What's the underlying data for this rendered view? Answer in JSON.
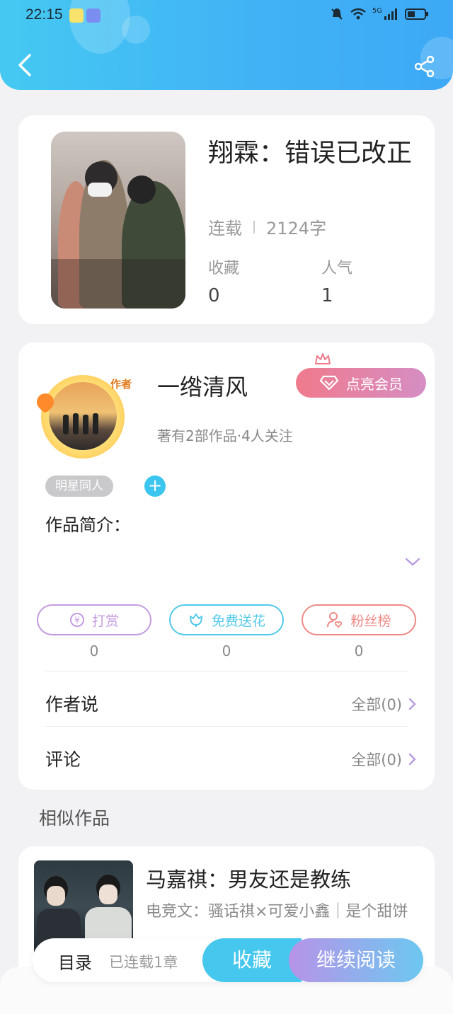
{
  "status_bar": {
    "time": "22:15",
    "network": "5G"
  },
  "book": {
    "title": "翔霖：错误已改正",
    "status": "连载",
    "word_count": "2124字",
    "stats": [
      {
        "label": "收藏",
        "value": "0"
      },
      {
        "label": "人气",
        "value": "1"
      }
    ]
  },
  "author": {
    "name": "一绺清风",
    "badge": "作者",
    "vip_button": "点亮会员",
    "meta": "著有2部作品·4人关注",
    "tag": "明星同人",
    "tag_add": "+",
    "intro_label": "作品简介："
  },
  "actions": [
    {
      "label": "打赏",
      "value": "0",
      "color": "#c49be0"
    },
    {
      "label": "免费送花",
      "value": "0",
      "color": "#53c9ea"
    },
    {
      "label": "粉丝榜",
      "value": "0",
      "color": "#ee8a86"
    }
  ],
  "rows": [
    {
      "label": "作者说",
      "right": "全部(0)"
    },
    {
      "label": "评论",
      "right": "全部(0)"
    }
  ],
  "similar": {
    "heading": "相似作品",
    "items": [
      {
        "title": "马嘉祺：男友还是教练",
        "desc": "电竞文：骚话祺×可爱小鑫｜是个甜饼"
      }
    ]
  },
  "bottom_bar": {
    "toc": "目录",
    "toc_sub": "已连载1章",
    "collect": "收藏",
    "read": "继续阅读"
  },
  "colors": {
    "accent": "#41b8f4",
    "vip_start": "#f07a8c",
    "vip_end": "#d58ec4"
  }
}
